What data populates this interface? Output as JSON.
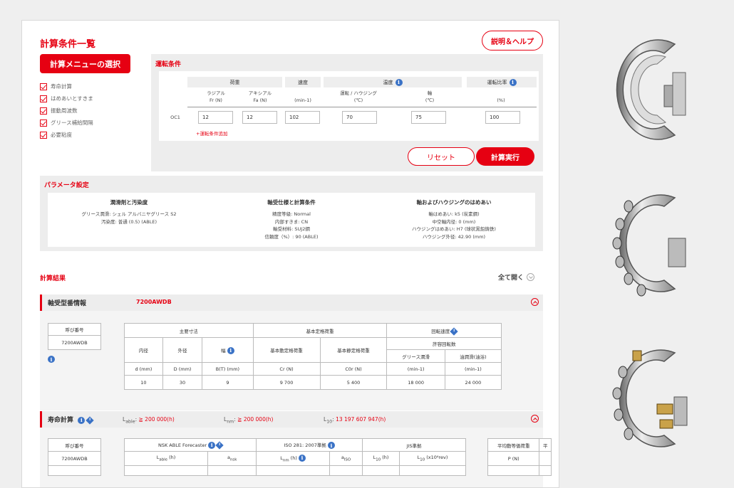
{
  "header": {
    "title": "計算条件一覧",
    "help_label": "説明＆ヘルプ"
  },
  "menu": {
    "select_label": "計算メニューの選択",
    "items": [
      "寿命計算",
      "はめあいとすきま",
      "振動周波数",
      "グリース補給間隔",
      "必要粘度"
    ]
  },
  "operating": {
    "title": "運転条件",
    "headers": {
      "load": "荷重",
      "speed": "速度",
      "temp": "温度",
      "ratio": "運転比率"
    },
    "sub": {
      "radial": "ラジアル",
      "radial_unit": "Fr (N)",
      "axial": "アキシアル",
      "axial_unit": "Fa (N)",
      "speed_unit": "(min-1)",
      "outer": "運転 / ハウジング",
      "outer_unit": "(℃)",
      "shaft": "軸",
      "shaft_unit": "(℃)",
      "ratio_unit": "(%)"
    },
    "row_label": "OC1",
    "values": {
      "fr": "12",
      "fa": "12",
      "speed": "102",
      "temp_outer": "70",
      "temp_shaft": "75",
      "ratio": "100"
    },
    "add_label": "+運転条件追加",
    "reset_label": "リセット",
    "calc_label": "計算実行"
  },
  "params": {
    "title": "パラメータ設定",
    "col1": {
      "heading": "潤滑剤と汚染度",
      "lines": [
        "グリース潤滑: シェル アルバニヤグリース S2",
        "汚染度: 普通 (0.5) (ABLE)"
      ]
    },
    "col2": {
      "heading": "軸受仕様と計算条件",
      "lines": [
        "精度等級: Normal",
        "内部すきま: CN",
        "軸受材料: SUJ2鋼",
        "信頼度（%）: 90 (ABLE)"
      ]
    },
    "col3": {
      "heading": "軸およびハウジングのはめあい",
      "lines": [
        "軸はめあい: k5 (炭素鋼)",
        "中空軸内径: 0 (mm)",
        "ハウジングはめあい: H7 (球状黒鉛鋳鉄)",
        "ハウジング外径: 42.90 (mm)"
      ]
    }
  },
  "results": {
    "title": "計算結果",
    "expand_all": "全て開く",
    "bearing_info": {
      "label": "軸受型番情報",
      "model": "7200AWDB",
      "designation_header": "呼び番号",
      "designation": "7200AWDB",
      "main_dim": "主要寸法",
      "load_rating": "基本定格荷重",
      "speed": "回転速度",
      "allow_speed": "許容回転数",
      "cols": [
        "内径",
        "外径",
        "幅",
        "基本動定格荷重",
        "基本静定格荷重",
        "グリース潤滑",
        "油潤滑(油浴)"
      ],
      "units": [
        "d (mm)",
        "D (mm)",
        "B(T) (mm)",
        "Cr (N)",
        "C0r (N)",
        "(min-1)",
        "(min-1)"
      ],
      "values": [
        "10",
        "30",
        "9",
        "9 700",
        "5 400",
        "18 000",
        "24 000"
      ]
    },
    "life": {
      "label": "寿命計算",
      "lable_text": "≧ 200 000(h)",
      "lnm_text": "≧ 200 000(h)",
      "l10_text": "13 197 607 947(h)",
      "designation_header": "呼び番号",
      "designation": "7200AWDB",
      "groups": [
        "NSK ABLE Forecaster",
        "ISO 281: 2007準拠",
        "JIS準拠",
        "平均動等価荷重",
        "平"
      ],
      "cols": [
        "(h)",
        "(h)",
        "",
        "(h)",
        "(x10⁶rev)",
        "P (N)"
      ]
    }
  }
}
